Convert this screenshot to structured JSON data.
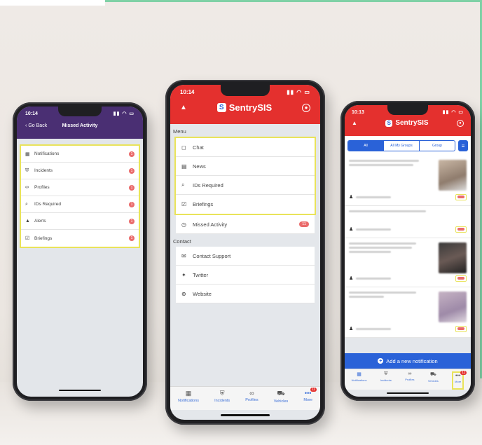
{
  "colors": {
    "purple_header": "#4a2f73",
    "red_header": "#e4302e",
    "highlight_yellow": "#e9e35a",
    "badge_red": "#ea6b6b",
    "primary_blue": "#2a62d8",
    "accent_green": "#7fd1a6"
  },
  "left_phone": {
    "time": "10:14",
    "back_label": "Go Back",
    "title": "Missed Activity",
    "items": [
      {
        "label": "Notifications",
        "icon": "grid-icon"
      },
      {
        "label": "Incidents",
        "icon": "shield-icon"
      },
      {
        "label": "Profiles",
        "icon": "glasses-icon"
      },
      {
        "label": "IDs Required",
        "icon": "search-icon"
      },
      {
        "label": "Alerts",
        "icon": "alert-icon"
      },
      {
        "label": "Briefings",
        "icon": "checklist-icon"
      }
    ]
  },
  "center_phone": {
    "time": "10:14",
    "brand": "SentrySIS",
    "menu_label": "Menu",
    "menu_items": [
      {
        "label": "Chat",
        "icon": "chat-icon"
      },
      {
        "label": "News",
        "icon": "news-icon"
      },
      {
        "label": "IDs Required",
        "icon": "search-icon"
      },
      {
        "label": "Briefings",
        "icon": "checklist-icon"
      }
    ],
    "missed_activity": {
      "label": "Missed Activity",
      "icon": "clock-icon"
    },
    "contact_label": "Contact",
    "contact_items": [
      {
        "label": "Contact Support",
        "icon": "mail-icon"
      },
      {
        "label": "Twitter",
        "icon": "twitter-icon"
      },
      {
        "label": "Website",
        "icon": "globe-icon"
      }
    ],
    "tabs": [
      {
        "label": "Notifications",
        "icon": "grid-icon"
      },
      {
        "label": "Incidents",
        "icon": "shield-icon"
      },
      {
        "label": "Profiles",
        "icon": "glasses-icon"
      },
      {
        "label": "Vehicles",
        "icon": "car-icon"
      },
      {
        "label": "More",
        "icon": "more-icon"
      }
    ]
  },
  "right_phone": {
    "time": "10:13",
    "brand": "SentrySIS",
    "segments": [
      "All",
      "All My Groups",
      "Group"
    ],
    "add_label": "Add a new notification",
    "tabs": [
      {
        "label": "Notifications",
        "icon": "grid-icon"
      },
      {
        "label": "Incidents",
        "icon": "shield-icon"
      },
      {
        "label": "Profiles",
        "icon": "glasses-icon"
      },
      {
        "label": "Vehicles",
        "icon": "car-icon"
      },
      {
        "label": "More",
        "icon": "more-icon"
      }
    ]
  }
}
